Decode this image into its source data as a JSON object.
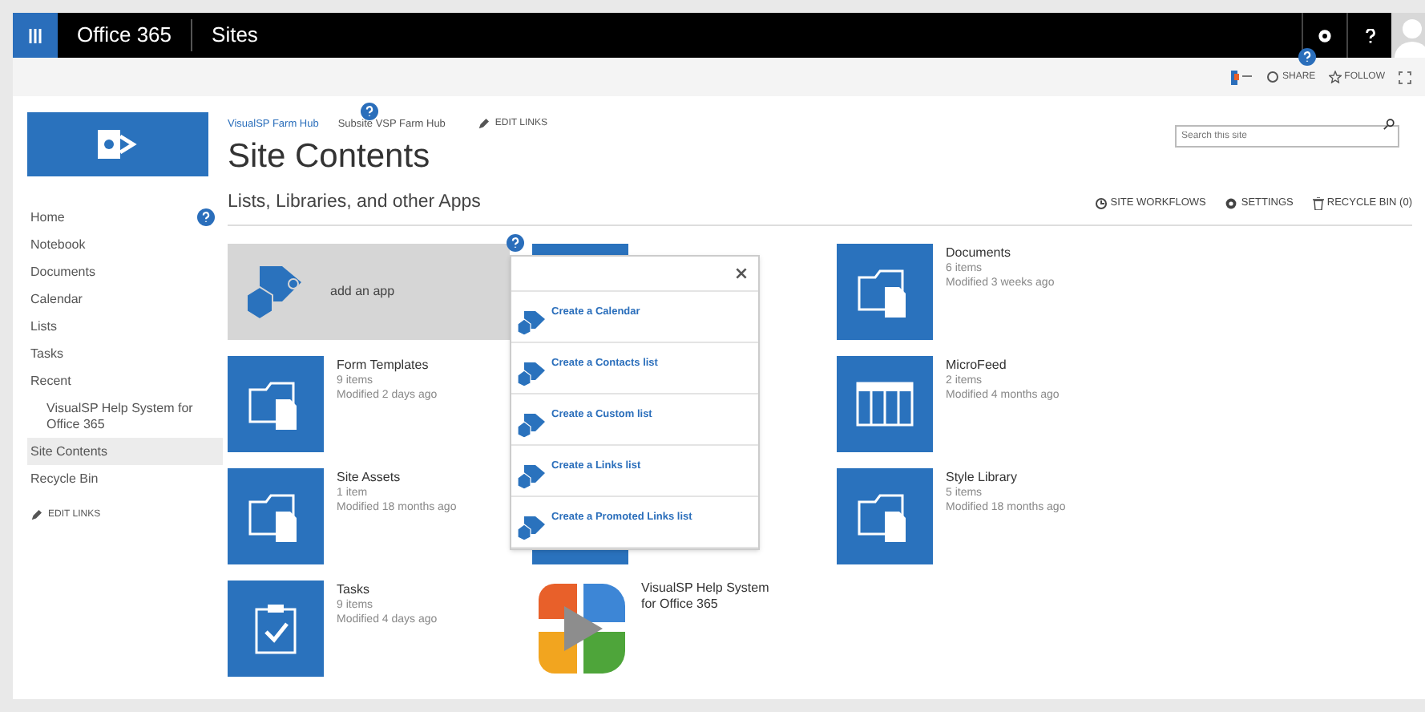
{
  "top_bar": {
    "app_name": "Office 365",
    "section": "Sites"
  },
  "ribbon": {
    "actions": [
      {
        "label": "SHARE",
        "kind": "share"
      },
      {
        "label": "FOLLOW",
        "kind": "follow"
      }
    ]
  },
  "header": {
    "breadcrumbs": [
      "VisualSP Farm Hub",
      "Subsite VSP Farm Hub"
    ],
    "edit_links": "EDIT LINKS",
    "page_title": "Site Contents",
    "search": {
      "placeholder": "Search this site"
    }
  },
  "sidebar": {
    "items": [
      {
        "label": "Home",
        "selected": false
      },
      {
        "label": "Notebook",
        "selected": false
      },
      {
        "label": "Documents",
        "selected": false
      },
      {
        "label": "Calendar",
        "selected": false
      },
      {
        "label": "Lists",
        "selected": false
      },
      {
        "label": "Tasks",
        "selected": false
      },
      {
        "label": "Recent",
        "selected": false,
        "children": [
          {
            "label": "VisualSP Help System for Office 365",
            "selected": false
          }
        ]
      },
      {
        "label": "Site Contents",
        "selected": true
      },
      {
        "label": "Recycle Bin",
        "selected": false
      }
    ],
    "edit_links": "EDIT LINKS"
  },
  "section": {
    "title": "Lists, Libraries, and other Apps",
    "actions": [
      {
        "label": "SITE WORKFLOWS",
        "kind": "workflow"
      },
      {
        "label": "SETTINGS",
        "kind": "settings"
      },
      {
        "label": "RECYCLE BIN (0)",
        "kind": "recycle"
      }
    ]
  },
  "add_app": {
    "label": "add an app"
  },
  "columns": [
    [
      {
        "kind": "folder",
        "name": "Form Templates",
        "items": "9 items",
        "modified": "Modified 2 days ago"
      },
      {
        "kind": "folder",
        "name": "Site Assets",
        "items": "1 item",
        "modified": "Modified 18 months ago"
      },
      {
        "kind": "tasks",
        "name": "Tasks",
        "items": "9 items",
        "modified": "Modified 4 days ago"
      }
    ],
    [
      {
        "kind": "covered"
      },
      {
        "kind": "covered_tall"
      },
      {
        "kind": "logo",
        "name": "VisualSP Help System for Office 365"
      }
    ],
    [
      {
        "kind": "folder",
        "name": "Documents",
        "items": "6 items",
        "modified": "Modified 3 weeks ago"
      },
      {
        "kind": "list",
        "name": "MicroFeed",
        "items": "2 items",
        "modified": "Modified 4 months ago"
      },
      {
        "kind": "folder",
        "name": "Style Library",
        "items": "5 items",
        "modified": "Modified 18 months ago"
      }
    ]
  ],
  "popup": {
    "items": [
      "Create a Calendar",
      "Create a Contacts list",
      "Create a Custom list",
      "Create a Links list",
      "Create a Promoted Links list"
    ]
  }
}
